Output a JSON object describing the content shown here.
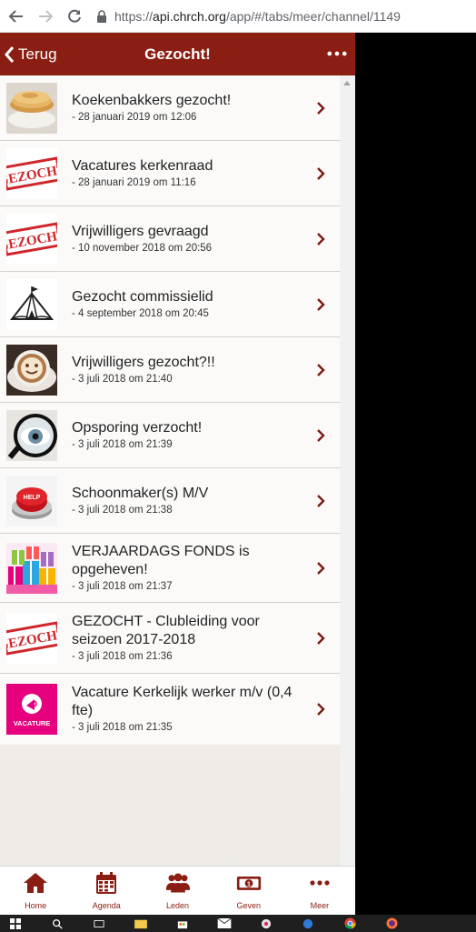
{
  "browser": {
    "url_scheme": "https://",
    "url_host": "api.chrch.org",
    "url_path": "/app/#/tabs/meer/channel/1149"
  },
  "header": {
    "back_label": "Terug",
    "title": "Gezocht!"
  },
  "items": [
    {
      "title": "Koekenbakkers gezocht!",
      "date": "- 28 januari 2019 om 12:06",
      "thumb": "pancakes"
    },
    {
      "title": "Vacatures kerkenraad",
      "date": "- 28 januari 2019 om 11:16",
      "thumb": "gezocht-stamp"
    },
    {
      "title": "Vrijwilligers gevraagd",
      "date": "- 10 november 2018 om 20:56",
      "thumb": "gezocht-stamp"
    },
    {
      "title": "Gezocht commissielid",
      "date": "- 4 september 2018 om 20:45",
      "thumb": "tent"
    },
    {
      "title": "Vrijwilligers gezocht?!!",
      "date": "- 3 juli 2018 om 21:40",
      "thumb": "coffee"
    },
    {
      "title": "Opsporing verzocht!",
      "date": "- 3 juli 2018 om 21:39",
      "thumb": "magnifier-eye"
    },
    {
      "title": "Schoonmaker(s) M/V",
      "date": "- 3 juli 2018 om 21:38",
      "thumb": "help-button"
    },
    {
      "title": "VERJAARDAGS FONDS is opgeheven!",
      "date": "- 3 juli 2018 om 21:37",
      "thumb": "presents"
    },
    {
      "title": "GEZOCHT - Clubleiding voor seizoen 2017-2018",
      "date": "- 3 juli 2018 om 21:36",
      "thumb": "gezocht-stamp"
    },
    {
      "title": "Vacature Kerkelijk werker m/v (0,4 fte)",
      "date": "- 3 juli 2018 om 21:35",
      "thumb": "vacature"
    }
  ],
  "thumb_text": {
    "stamp": "GEZOCHT",
    "help": "HELP",
    "vacature": "VACATURE"
  },
  "tabs": [
    {
      "label": "Home",
      "icon": "home-icon"
    },
    {
      "label": "Agenda",
      "icon": "calendar-icon"
    },
    {
      "label": "Leden",
      "icon": "people-icon"
    },
    {
      "label": "Geven",
      "icon": "money-icon"
    },
    {
      "label": "Meer",
      "icon": "more-icon"
    }
  ],
  "colors": {
    "brand": "#8a1e12",
    "vacature": "#e6007e"
  }
}
